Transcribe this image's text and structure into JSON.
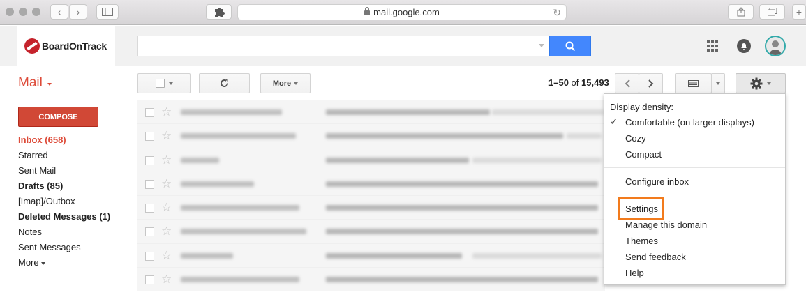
{
  "browser": {
    "url": "mail.google.com"
  },
  "header": {
    "brand_name": "BoardOnTrack"
  },
  "toolbar": {
    "mail_label": "Mail",
    "more_label": "More",
    "range": "1–50",
    "of_label": "of",
    "total": "15,493"
  },
  "sidebar": {
    "compose_label": "COMPOSE",
    "items": [
      {
        "label": "Inbox (658)"
      },
      {
        "label": "Starred"
      },
      {
        "label": "Sent Mail"
      },
      {
        "label": "Drafts (85)"
      },
      {
        "label": "[Imap]/Outbox"
      },
      {
        "label": "Deleted Messages (1)"
      },
      {
        "label": "Notes"
      },
      {
        "label": "Sent Messages"
      },
      {
        "label": "More"
      }
    ]
  },
  "settings_menu": {
    "heading": "Display density:",
    "density_options": [
      "Comfortable (on larger displays)",
      "Cozy",
      "Compact"
    ],
    "configure_inbox": "Configure inbox",
    "items": [
      "Settings",
      "Manage this domain",
      "Themes",
      "Send feedback",
      "Help"
    ]
  },
  "colors": {
    "accent_red": "#dd4b39",
    "search_blue": "#4387fd",
    "highlight_orange": "#f27b1d"
  }
}
